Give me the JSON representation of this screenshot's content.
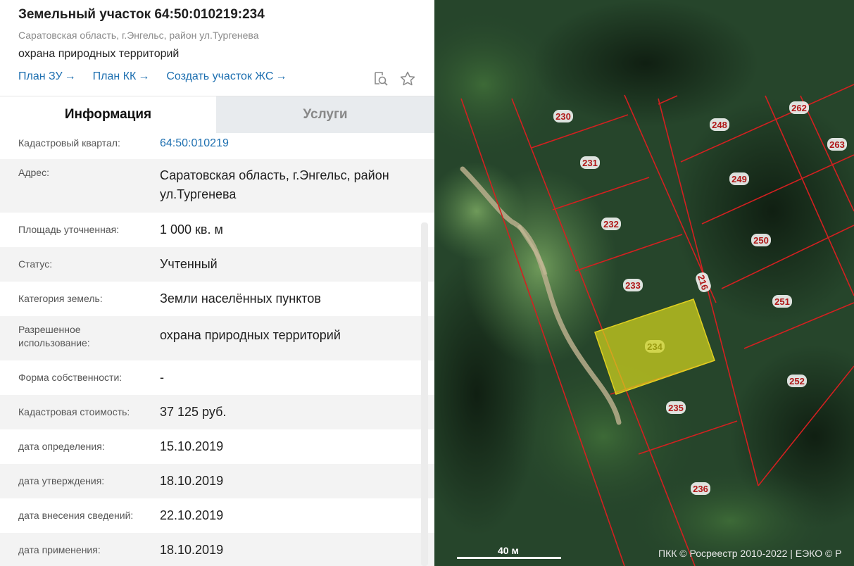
{
  "header": {
    "title": "Земельный участок 64:50:010219:234",
    "address": "Саратовская область, г.Энгельс, район ул.Тургенева",
    "usage": "охрана природных территорий",
    "links": [
      {
        "label": "План ЗУ",
        "arrow": "→"
      },
      {
        "label": "План КК",
        "arrow": "→"
      },
      {
        "label": "Создать участок ЖС",
        "arrow": "→"
      }
    ],
    "icons": [
      "search-document-icon",
      "star-icon"
    ]
  },
  "tabs": [
    {
      "label": "Информация",
      "active": true
    },
    {
      "label": "Услуги",
      "active": false
    }
  ],
  "info": {
    "rows": [
      {
        "label": "Кадастровый квартал:",
        "value": "64:50:010219"
      },
      {
        "label": "Адрес:",
        "value": "Саратовская область, г.Энгельс, район ул.Тургенева"
      },
      {
        "label": "Площадь уточненная:",
        "value": "1 000 кв. м"
      },
      {
        "label": "Статус:",
        "value": "Учтенный"
      },
      {
        "label": "Категория земель:",
        "value": "Земли населённых пунктов"
      },
      {
        "label": "Разрешенное использование:",
        "value": "охрана природных территорий"
      },
      {
        "label": "Форма собственности:",
        "value": "-"
      },
      {
        "label": "Кадастровая стоимость:",
        "value": "37 125 руб."
      },
      {
        "label": "дата определения:",
        "value": "15.10.2019"
      },
      {
        "label": "дата утверждения:",
        "value": "18.10.2019"
      },
      {
        "label": "дата внесения сведений:",
        "value": "22.10.2019"
      },
      {
        "label": "дата применения:",
        "value": "18.10.2019"
      }
    ]
  },
  "map": {
    "plots": [
      "230",
      "231",
      "232",
      "233",
      "234",
      "235",
      "236",
      "248",
      "249",
      "250",
      "251",
      "252",
      "262",
      "263",
      "216"
    ],
    "selected_plot": "234",
    "scale_label": "40 м",
    "copyright": "ПКК © Росреестр 2010-2022 | ЕЭКО © Р",
    "colors": {
      "boundary": "#d42020",
      "selected_fill": "#d7d81e",
      "forest": "#24422a"
    }
  }
}
